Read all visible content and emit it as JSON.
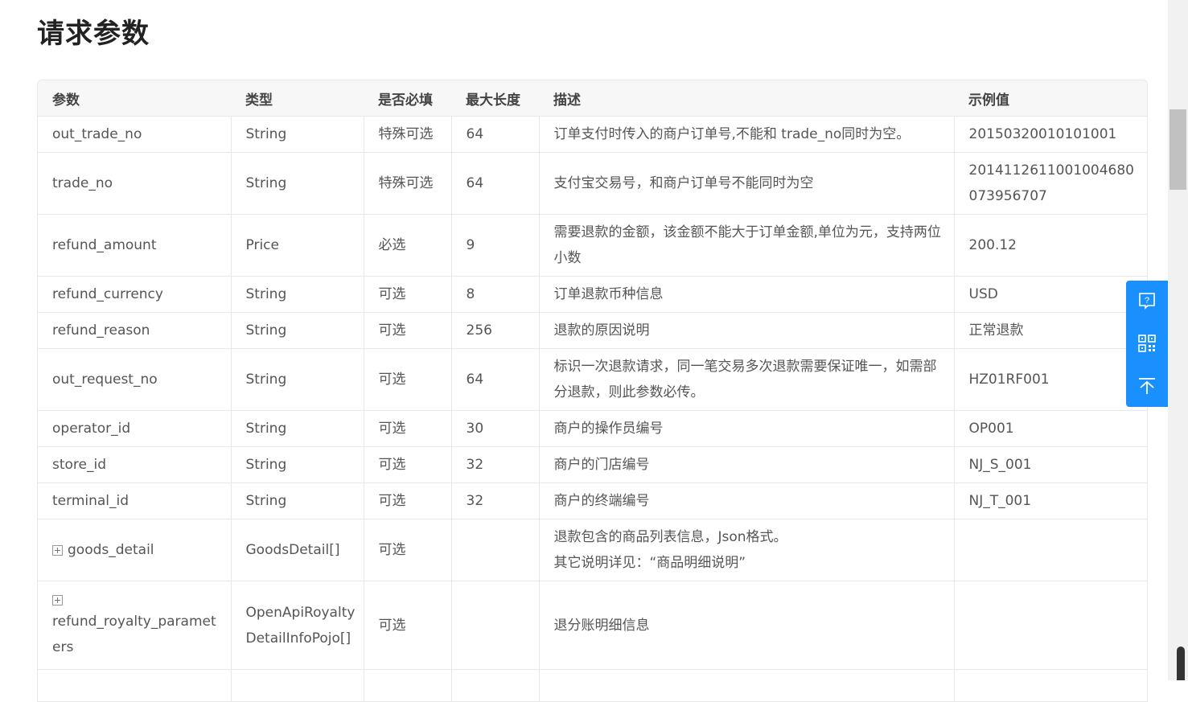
{
  "page": {
    "title": "请求参数"
  },
  "table": {
    "headers": [
      "参数",
      "类型",
      "是否必填",
      "最大长度",
      "描述",
      "示例值"
    ],
    "rows": [
      {
        "param": "out_trade_no",
        "type": "String",
        "required": "特殊可选",
        "maxlen": "64",
        "desc": "订单支付时传入的商户订单号,不能和 trade_no同时为空。",
        "example": "20150320010101001",
        "expandable": false
      },
      {
        "param": "trade_no",
        "type": "String",
        "required": "特殊可选",
        "maxlen": "64",
        "desc": "支付宝交易号，和商户订单号不能同时为空",
        "example": "2014112611001004680073956707",
        "expandable": false
      },
      {
        "param": "refund_amount",
        "type": "Price",
        "required": "必选",
        "maxlen": "9",
        "desc": "需要退款的金额，该金额不能大于订单金额,单位为元，支持两位小数",
        "example": "200.12",
        "expandable": false
      },
      {
        "param": "refund_currency",
        "type": "String",
        "required": "可选",
        "maxlen": "8",
        "desc": "订单退款币种信息",
        "example": "USD",
        "expandable": false
      },
      {
        "param": "refund_reason",
        "type": "String",
        "required": "可选",
        "maxlen": "256",
        "desc": "退款的原因说明",
        "example": "正常退款",
        "expandable": false
      },
      {
        "param": "out_request_no",
        "type": "String",
        "required": "可选",
        "maxlen": "64",
        "desc": "标识一次退款请求，同一笔交易多次退款需要保证唯一，如需部分退款，则此参数必传。",
        "example": "HZ01RF001",
        "expandable": false
      },
      {
        "param": "operator_id",
        "type": "String",
        "required": "可选",
        "maxlen": "30",
        "desc": "商户的操作员编号",
        "example": "OP001",
        "expandable": false
      },
      {
        "param": "store_id",
        "type": "String",
        "required": "可选",
        "maxlen": "32",
        "desc": "商户的门店编号",
        "example": "NJ_S_001",
        "expandable": false
      },
      {
        "param": "terminal_id",
        "type": "String",
        "required": "可选",
        "maxlen": "32",
        "desc": "商户的终端编号",
        "example": "NJ_T_001",
        "expandable": false
      },
      {
        "param": "goods_detail",
        "type": "GoodsDetail[]",
        "required": "可选",
        "maxlen": "",
        "desc": "退款包含的商品列表信息，Json格式。",
        "desc2": "其它说明详见：“商品明细说明”",
        "example": "",
        "expandable": true
      },
      {
        "param": "refund_royalty_parameters",
        "type": "OpenApiRoyaltyDetailInfoPojo[]",
        "required": "可选",
        "maxlen": "",
        "desc": "退分账明细信息",
        "example": "",
        "expandable": true
      }
    ]
  },
  "side_panel": {
    "buttons": [
      {
        "icon": "help-icon"
      },
      {
        "icon": "qrcode-icon"
      },
      {
        "icon": "back-to-top-icon"
      }
    ],
    "color": "#1a90ff"
  }
}
